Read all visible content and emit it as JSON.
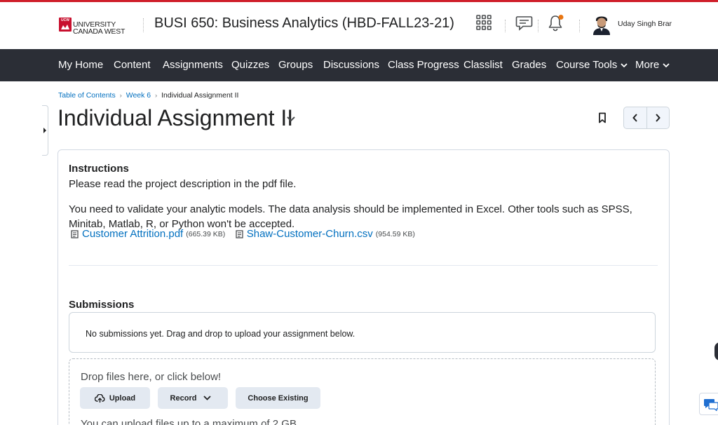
{
  "brand": {
    "logo_mark": "UCW",
    "logo_line1": "UNIVERSITY",
    "logo_line2": "CANADA WEST",
    "accent_color": "#cf1e2a"
  },
  "header": {
    "course_title": "BUSI 650: Business Analytics (HBD-FALL23-21)",
    "user_name": "Uday Singh Brar",
    "icons": [
      "grid-icon",
      "chat-icon",
      "bell-icon",
      "avatar"
    ]
  },
  "nav": {
    "items": [
      {
        "label": "My Home"
      },
      {
        "label": "Content"
      },
      {
        "label": "Assignments"
      },
      {
        "label": "Quizzes"
      },
      {
        "label": "Groups"
      },
      {
        "label": "Discussions"
      },
      {
        "label": "Class Progress"
      },
      {
        "label": "Classlist"
      },
      {
        "label": "Grades"
      },
      {
        "label": "Course Tools"
      },
      {
        "label": "More"
      }
    ]
  },
  "breadcrumb": {
    "items": [
      "Table of Contents",
      "Week 6"
    ],
    "current": "Individual Assignment II"
  },
  "page": {
    "title": "Individual Assignment II"
  },
  "instructions": {
    "heading": "Instructions",
    "paragraph1": "Please read the project description in the pdf file.",
    "paragraph2": "You need to validate your analytic models. The data analysis should be implemented in Excel. Other tools such as SPSS, Minitab, Matlab, R, or Python won't be accepted.",
    "files": [
      {
        "name": "Customer Attrition.pdf",
        "size": "(665.39 KB)"
      },
      {
        "name": "Shaw-Customer-Churn.csv",
        "size": "(954.59 KB)"
      }
    ]
  },
  "submissions": {
    "heading": "Submissions",
    "empty_message": "No submissions yet. Drag and drop to upload your assignment below.",
    "drop_text": "Drop files here, or click below!",
    "upload_label": "Upload",
    "record_label": "Record",
    "choose_label": "Choose Existing",
    "limit_text": "You can upload files up to a maximum of 2 GB."
  }
}
